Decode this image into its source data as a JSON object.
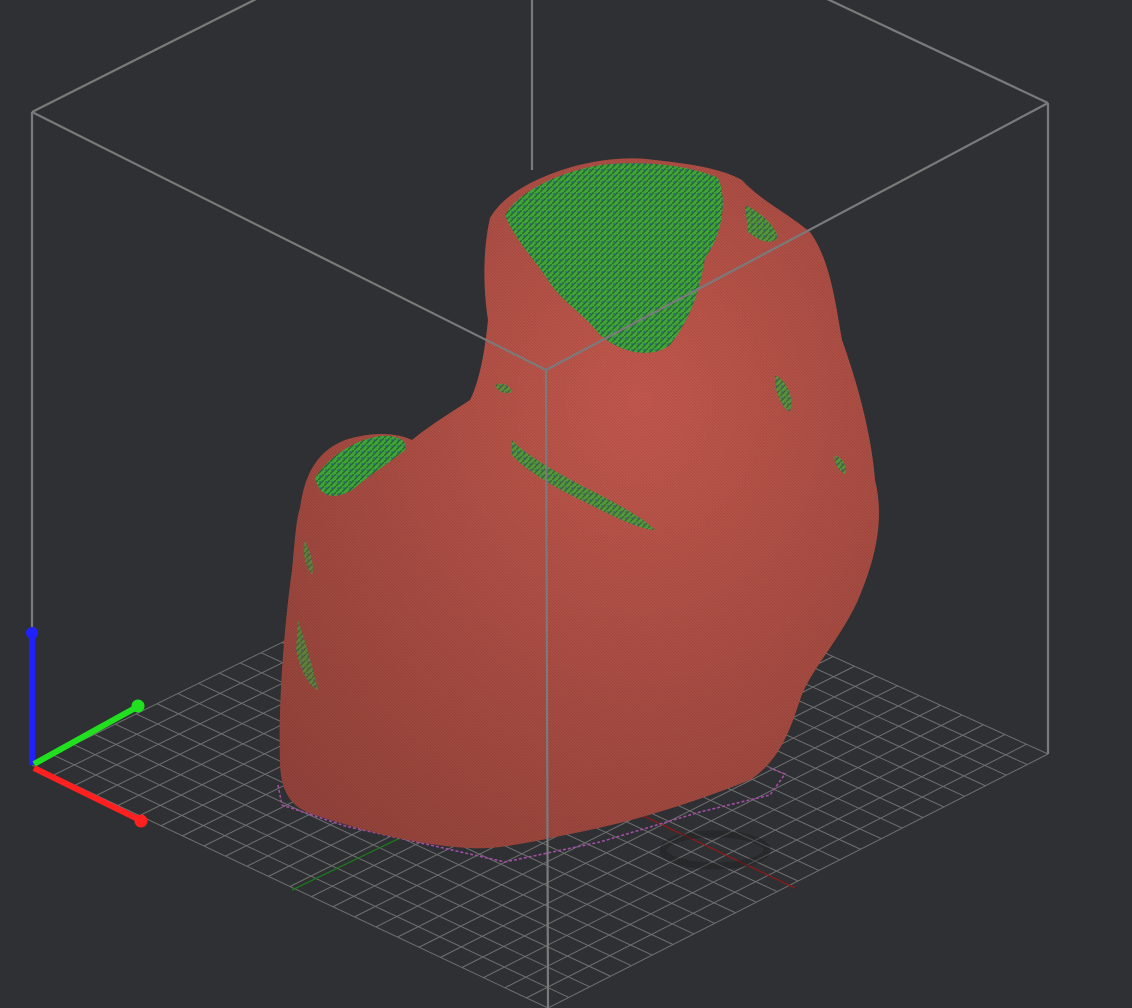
{
  "viewport": {
    "background": "#2e3033",
    "build_volume_color": "#7a7a7a",
    "bed_grid_color": "#6f6f6f",
    "model": {
      "base_color": "#c0574c",
      "overhang_highlight_color": "#3ecf3e",
      "skirt_outline_color": "#a24ea6"
    },
    "axes_gizmo": {
      "x_color": "#ff2020",
      "y_color": "#20e020",
      "z_color": "#2020ff"
    },
    "bed_axis_lines": {
      "x_color": "#8a1a1a",
      "y_color": "#1a7a1a"
    }
  }
}
